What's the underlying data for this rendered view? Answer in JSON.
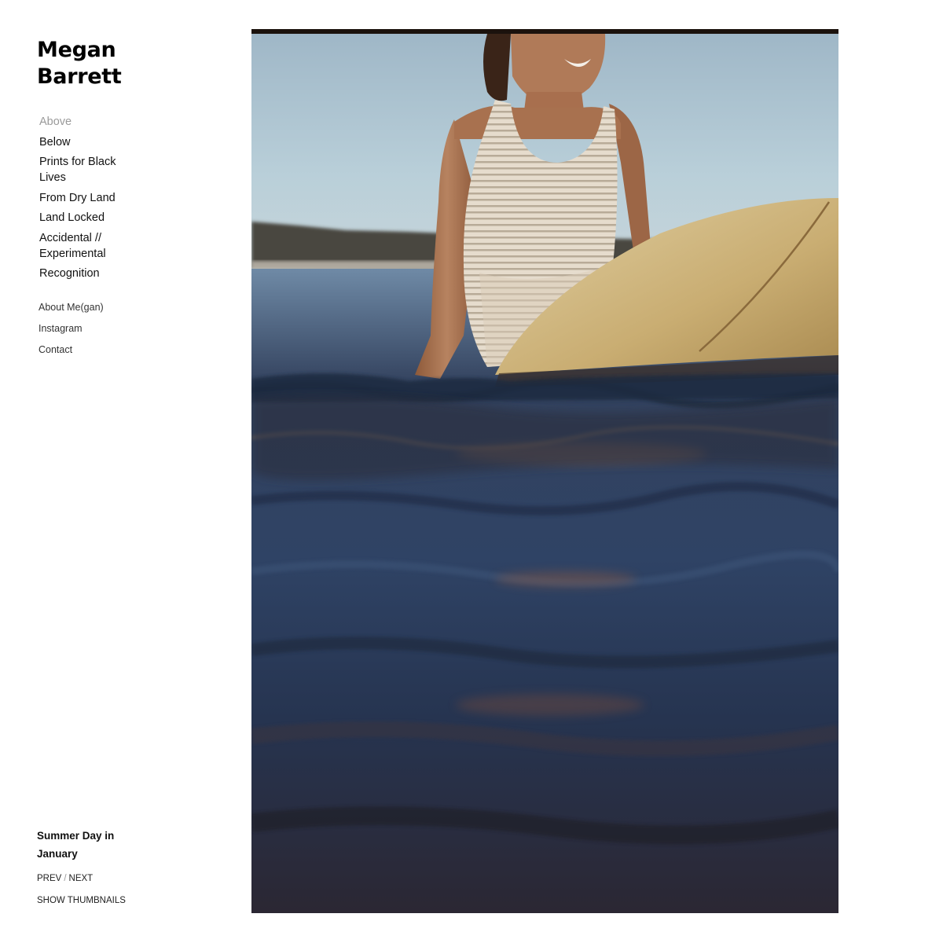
{
  "site": {
    "title_line1": "Megan",
    "title_line2": "Barrett"
  },
  "nav": {
    "main": [
      {
        "label": "Above",
        "active": true
      },
      {
        "label": "Below",
        "active": false
      },
      {
        "label": "Prints for Black Lives",
        "active": false
      },
      {
        "label": "From Dry Land",
        "active": false
      },
      {
        "label": "Land Locked",
        "active": false
      },
      {
        "label": "Accidental // Experimental",
        "active": false
      },
      {
        "label": "Recognition",
        "active": false
      }
    ],
    "secondary": [
      {
        "label": "About Me(gan)"
      },
      {
        "label": "Instagram"
      },
      {
        "label": "Contact"
      }
    ]
  },
  "gallery": {
    "caption": "Summer Day in January",
    "prev_label": "PREV",
    "separator": "/",
    "next_label": "NEXT",
    "thumbnails_label": "SHOW THUMBNAILS"
  },
  "colors": {
    "active_nav": "#9a9a9a",
    "text": "#111111",
    "background": "#ffffff"
  }
}
